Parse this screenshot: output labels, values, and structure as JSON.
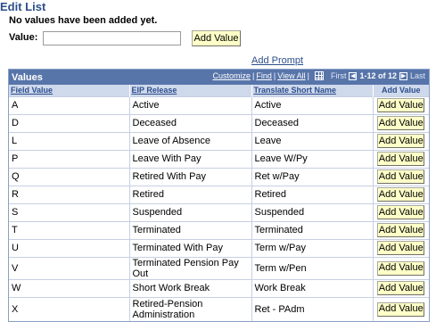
{
  "page": {
    "title": "Edit List",
    "no_values_msg": "No values have been added yet.",
    "value_label": "Value:",
    "value_input": "",
    "add_value_button": "Add Value",
    "add_prompt_link": "Add Prompt"
  },
  "grid": {
    "title": "Values",
    "nav": {
      "customize": "Customize",
      "find": "Find",
      "view_all": "View All",
      "first": "First",
      "range": "1-12 of 12",
      "last": "Last",
      "prev_icon": "prev-arrow-icon",
      "next_icon": "next-arrow-icon",
      "download_icon": "grid-download-icon"
    },
    "columns": [
      "Field Value",
      "EIP Release",
      "Translate Short Name",
      "Add Value"
    ],
    "button_label": "Add Value",
    "rows": [
      {
        "field_value": "A",
        "eip_release": "Active",
        "short_name": "Active"
      },
      {
        "field_value": "D",
        "eip_release": "Deceased",
        "short_name": "Deceased"
      },
      {
        "field_value": "L",
        "eip_release": "Leave of Absence",
        "short_name": "Leave"
      },
      {
        "field_value": "P",
        "eip_release": "Leave With Pay",
        "short_name": "Leave W/Py"
      },
      {
        "field_value": "Q",
        "eip_release": "Retired With Pay",
        "short_name": "Ret w/Pay"
      },
      {
        "field_value": "R",
        "eip_release": "Retired",
        "short_name": "Retired"
      },
      {
        "field_value": "S",
        "eip_release": "Suspended",
        "short_name": "Suspended"
      },
      {
        "field_value": "T",
        "eip_release": "Terminated",
        "short_name": "Terminated"
      },
      {
        "field_value": "U",
        "eip_release": "Terminated With Pay",
        "short_name": "Term w/Pay"
      },
      {
        "field_value": "V",
        "eip_release": "Terminated Pension Pay Out",
        "short_name": "Term w/Pen"
      },
      {
        "field_value": "W",
        "eip_release": "Short Work Break",
        "short_name": "Work Break"
      },
      {
        "field_value": "X",
        "eip_release": "Retired-Pension Administration",
        "short_name": "Ret - PAdm"
      }
    ]
  },
  "colors": {
    "title_blue": "#2d4e8c",
    "grid_header": "#5875aa",
    "column_header": "#cfd9ec",
    "button_bg": "#ffffc8"
  }
}
